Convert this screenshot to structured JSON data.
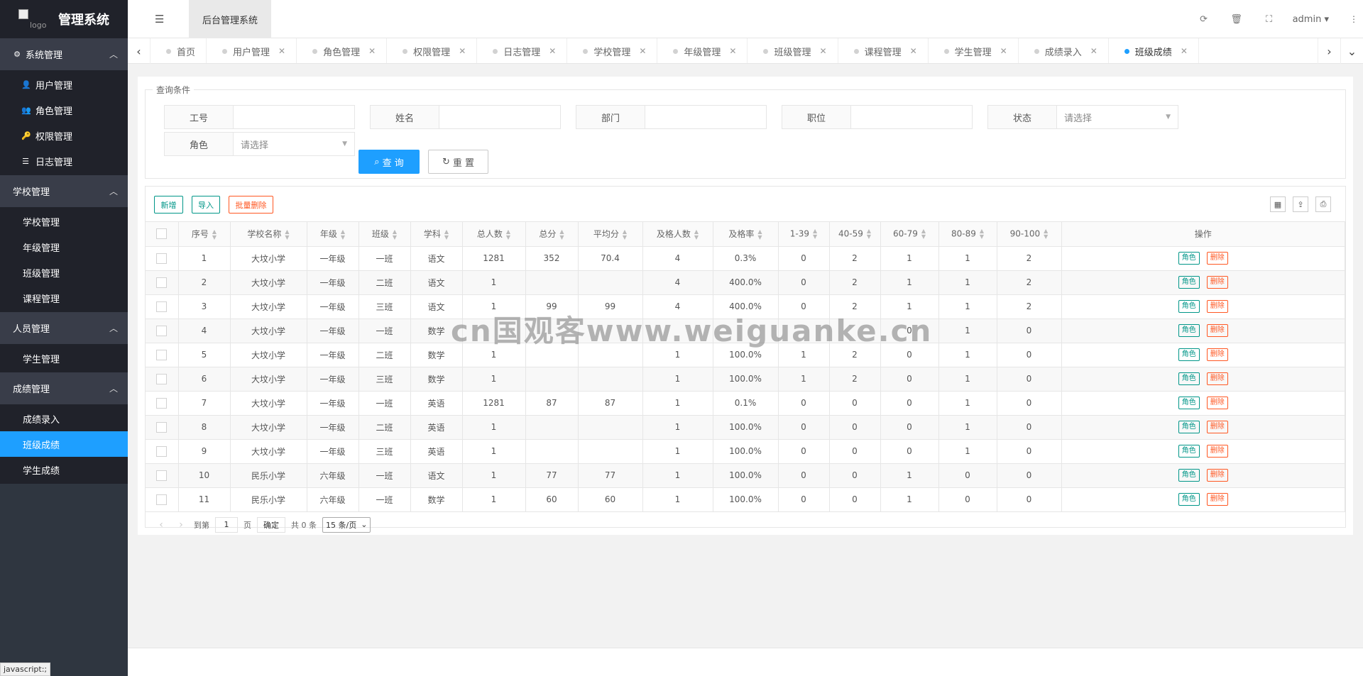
{
  "brand": {
    "logo_alt": "logo",
    "title": "管理系统"
  },
  "sidebar": {
    "groups": [
      {
        "label": "系统管理",
        "items": [
          {
            "label": "用户管理"
          },
          {
            "label": "角色管理"
          },
          {
            "label": "权限管理"
          },
          {
            "label": "日志管理"
          }
        ]
      },
      {
        "label": "学校管理",
        "items": [
          {
            "label": "学校管理"
          },
          {
            "label": "年级管理"
          },
          {
            "label": "班级管理"
          },
          {
            "label": "课程管理"
          }
        ]
      },
      {
        "label": "人员管理",
        "items": [
          {
            "label": "学生管理"
          }
        ]
      },
      {
        "label": "成绩管理",
        "items": [
          {
            "label": "成绩录入"
          },
          {
            "label": "班级成绩"
          },
          {
            "label": "学生成绩"
          }
        ]
      }
    ],
    "active_item": "班级成绩"
  },
  "status_tip": "javascript:;",
  "header": {
    "system_tab": "后台管理系统",
    "user": "admin"
  },
  "tabs": [
    {
      "label": "首页"
    },
    {
      "label": "用户管理"
    },
    {
      "label": "角色管理"
    },
    {
      "label": "权限管理"
    },
    {
      "label": "日志管理"
    },
    {
      "label": "学校管理"
    },
    {
      "label": "年级管理"
    },
    {
      "label": "班级管理"
    },
    {
      "label": "课程管理"
    },
    {
      "label": "学生管理"
    },
    {
      "label": "成绩录入"
    },
    {
      "label": "班级成绩"
    }
  ],
  "active_tab": "班级成绩",
  "query": {
    "legend": "查询条件",
    "fields": [
      {
        "label": "工号",
        "value": ""
      },
      {
        "label": "姓名",
        "value": ""
      },
      {
        "label": "部门",
        "value": ""
      },
      {
        "label": "职位",
        "value": ""
      },
      {
        "label": "状态",
        "placeholder": "请选择"
      },
      {
        "label": "角色",
        "placeholder": "请选择"
      }
    ],
    "search_label": "查 询",
    "reset_label": "重 置"
  },
  "toolbar": {
    "add": "新增",
    "import": "导入",
    "batch_delete": "批量删除"
  },
  "table": {
    "columns": [
      "序号",
      "学校名称",
      "年级",
      "班级",
      "学科",
      "总人数",
      "总分",
      "平均分",
      "及格人数",
      "及格率",
      "1-39",
      "40-59",
      "60-79",
      "80-89",
      "90-100",
      "操作"
    ],
    "rows": [
      [
        "1",
        "大坟小学",
        "一年级",
        "一班",
        "语文",
        "1281",
        "352",
        "70.4",
        "4",
        "0.3%",
        "0",
        "2",
        "1",
        "1",
        "2"
      ],
      [
        "2",
        "大坟小学",
        "一年级",
        "二班",
        "语文",
        "1",
        "",
        "",
        "4",
        "400.0%",
        "0",
        "2",
        "1",
        "1",
        "2"
      ],
      [
        "3",
        "大坟小学",
        "一年级",
        "三班",
        "语文",
        "1",
        "99",
        "99",
        "4",
        "400.0%",
        "0",
        "2",
        "1",
        "1",
        "2"
      ],
      [
        "4",
        "大坟小学",
        "一年级",
        "一班",
        "数学",
        "",
        "",
        "",
        "",
        "",
        "",
        "",
        "0",
        "1",
        "0"
      ],
      [
        "5",
        "大坟小学",
        "一年级",
        "二班",
        "数学",
        "1",
        "",
        "",
        "1",
        "100.0%",
        "1",
        "2",
        "0",
        "1",
        "0"
      ],
      [
        "6",
        "大坟小学",
        "一年级",
        "三班",
        "数学",
        "1",
        "",
        "",
        "1",
        "100.0%",
        "1",
        "2",
        "0",
        "1",
        "0"
      ],
      [
        "7",
        "大坟小学",
        "一年级",
        "一班",
        "英语",
        "1281",
        "87",
        "87",
        "1",
        "0.1%",
        "0",
        "0",
        "0",
        "1",
        "0"
      ],
      [
        "8",
        "大坟小学",
        "一年级",
        "二班",
        "英语",
        "1",
        "",
        "",
        "1",
        "100.0%",
        "0",
        "0",
        "0",
        "1",
        "0"
      ],
      [
        "9",
        "大坟小学",
        "一年级",
        "三班",
        "英语",
        "1",
        "",
        "",
        "1",
        "100.0%",
        "0",
        "0",
        "0",
        "1",
        "0"
      ],
      [
        "10",
        "民乐小学",
        "六年级",
        "一班",
        "语文",
        "1",
        "77",
        "77",
        "1",
        "100.0%",
        "0",
        "0",
        "1",
        "0",
        "0"
      ],
      [
        "11",
        "民乐小学",
        "六年级",
        "一班",
        "数学",
        "1",
        "60",
        "60",
        "1",
        "100.0%",
        "0",
        "0",
        "1",
        "0",
        "0"
      ]
    ],
    "row_actions": {
      "role": "角色",
      "delete": "删除"
    }
  },
  "pager": {
    "goto": "到第",
    "page": "1",
    "page_unit": "页",
    "confirm": "确定",
    "total": "共 0 条",
    "size": "15 条/页"
  },
  "watermark": "cn国观客www.weiguanke.cn"
}
